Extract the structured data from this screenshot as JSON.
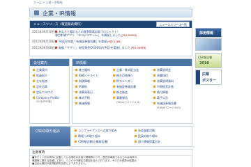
{
  "breadcrumb": "ホーム > 企業・IR情報",
  "page_title": "企業・IR情報",
  "news": {
    "header": "ニュースリリース（報道発表資料）",
    "more_button": "ニュースリリース一覧",
    "items": [
      {
        "date": "2011年06月10日",
        "text": "あなたと陽のもとの夏季節電応援プロジェクト！",
        "sub": "電力削減アプリ 「エコデコサーム」 を開発しました",
        "sub_tag": "[PDF:600KB]"
      },
      {
        "date": "2011年06月10日",
        "text": "平成22年度「有価証券報告書」を登録",
        "tag": "[PDF:21KB]"
      },
      {
        "date": "2011年06月08日",
        "text": "執務「サザン」 新型発売(2006年内予定)を実施しました",
        "tag": "[PDF:383KB]"
      }
    ]
  },
  "company": {
    "header": "会社案内",
    "items": [
      "企業案内",
      "役員紹介",
      "主な拠点",
      "会社沿革",
      "会社カタログ",
      "Company Profile"
    ],
    "note": "2010(PDF版)"
  },
  "ir": {
    "header": "IR情報",
    "col1": [
      "株主優待",
      "財務ハイライト",
      "財務情報",
      "IR資料",
      "決算発表日",
      "株式手続",
      "株価情報"
    ],
    "col2": [
      "企業・株式配当金",
      "株主の皆様へ",
      "IRカレンダー",
      "有価証券報告書",
      "株主総会",
      "事業報告",
      "(Yahooファイナンス)"
    ],
    "col3": [
      "決算説明会",
      "決算短信",
      "決算説明資料",
      "中期経営計画",
      "格付情報",
      "電子公告",
      "有価証券報告書",
      "(EDINETコード:E00)"
    ]
  },
  "csr": {
    "header": "CSRの取り組み",
    "links": [
      "コンプライアンスへの取り組み",
      "環境への取り組み",
      "CSR報告書(企業報告書)",
      "社会貢献活動",
      "役員の取り組み",
      "個人情報保護方針"
    ]
  },
  "notes": {
    "header": "注意事項",
    "lines": [
      "■本サイト内の資料に記載している現在の計画や戦略等のうち、歴史的事実でないものは将来の",
      "業績等に関する見通しであり、リスクや不確定な要因を含んでおります。そのため実際の結果は",
      "■当社は個別の投資勧誘を目的としておりません。"
    ]
  },
  "banners": {
    "recruit": "採用情報",
    "csr_report_title": "CSR報告書",
    "csr_report_year": "2010",
    "poster_line1": "広報",
    "poster_line2": "ポスター"
  },
  "colors": {
    "header_navy": "#1f4574",
    "box_header_blue": "#4a73a6",
    "link_blue": "#234a86",
    "bullet_orange": "#f0a020",
    "pdf_red": "#a31515"
  }
}
